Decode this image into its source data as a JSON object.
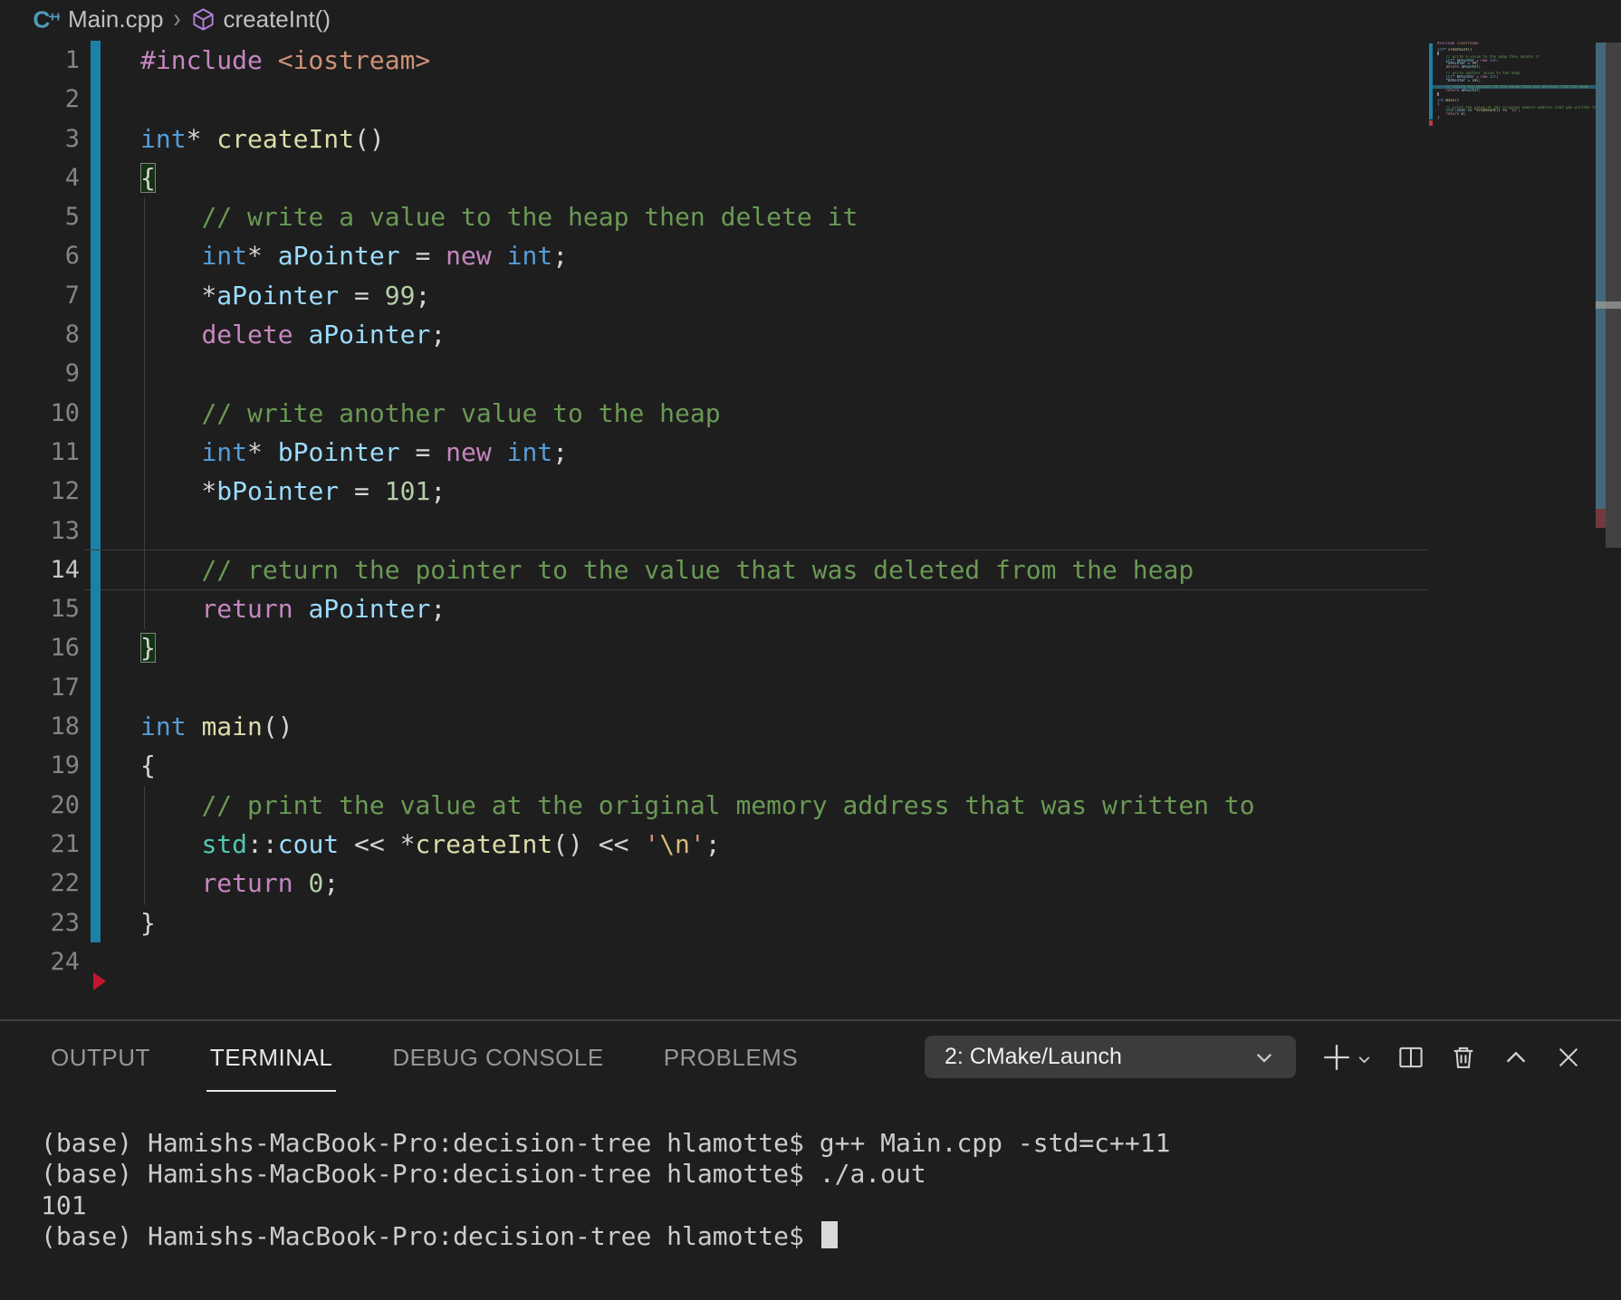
{
  "breadcrumb": {
    "file": "Main.cpp",
    "symbol": "createInt()"
  },
  "editor": {
    "cursor_line": 14,
    "lines": [
      {
        "n": 1,
        "git": true,
        "tokens": [
          [
            "pp",
            "#include"
          ],
          [
            "pl",
            " "
          ],
          [
            "str",
            "<iostream>"
          ]
        ]
      },
      {
        "n": 2,
        "git": true,
        "tokens": []
      },
      {
        "n": 3,
        "git": true,
        "tokens": [
          [
            "kw",
            "int"
          ],
          [
            "pl",
            "* "
          ],
          [
            "fn",
            "createInt"
          ],
          [
            "pl",
            "()"
          ]
        ]
      },
      {
        "n": 4,
        "git": true,
        "tokens": [
          [
            "brk",
            "{"
          ]
        ]
      },
      {
        "n": 5,
        "git": true,
        "tokens": [
          [
            "pl",
            "    "
          ],
          [
            "cm",
            "// write a value to the heap then delete it"
          ]
        ]
      },
      {
        "n": 6,
        "git": true,
        "tokens": [
          [
            "pl",
            "    "
          ],
          [
            "kw",
            "int"
          ],
          [
            "pl",
            "* "
          ],
          [
            "var",
            "aPointer"
          ],
          [
            "pl",
            " = "
          ],
          [
            "kwp",
            "new"
          ],
          [
            "pl",
            " "
          ],
          [
            "kw",
            "int"
          ],
          [
            "pl",
            ";"
          ]
        ]
      },
      {
        "n": 7,
        "git": true,
        "tokens": [
          [
            "pl",
            "    *"
          ],
          [
            "var",
            "aPointer"
          ],
          [
            "pl",
            " = "
          ],
          [
            "num",
            "99"
          ],
          [
            "pl",
            ";"
          ]
        ]
      },
      {
        "n": 8,
        "git": true,
        "tokens": [
          [
            "pl",
            "    "
          ],
          [
            "kwp",
            "delete"
          ],
          [
            "pl",
            " "
          ],
          [
            "var",
            "aPointer"
          ],
          [
            "pl",
            ";"
          ]
        ]
      },
      {
        "n": 9,
        "git": true,
        "tokens": []
      },
      {
        "n": 10,
        "git": true,
        "tokens": [
          [
            "pl",
            "    "
          ],
          [
            "cm",
            "// write another value to the heap"
          ]
        ]
      },
      {
        "n": 11,
        "git": true,
        "tokens": [
          [
            "pl",
            "    "
          ],
          [
            "kw",
            "int"
          ],
          [
            "pl",
            "* "
          ],
          [
            "var",
            "bPointer"
          ],
          [
            "pl",
            " = "
          ],
          [
            "kwp",
            "new"
          ],
          [
            "pl",
            " "
          ],
          [
            "kw",
            "int"
          ],
          [
            "pl",
            ";"
          ]
        ]
      },
      {
        "n": 12,
        "git": true,
        "tokens": [
          [
            "pl",
            "    *"
          ],
          [
            "var",
            "bPointer"
          ],
          [
            "pl",
            " = "
          ],
          [
            "num",
            "101"
          ],
          [
            "pl",
            ";"
          ]
        ]
      },
      {
        "n": 13,
        "git": true,
        "tokens": []
      },
      {
        "n": 14,
        "git": true,
        "tokens": [
          [
            "pl",
            "    "
          ],
          [
            "cm",
            "// return the pointer to the value that was deleted from the heap"
          ]
        ]
      },
      {
        "n": 15,
        "git": true,
        "tokens": [
          [
            "pl",
            "    "
          ],
          [
            "kwp",
            "return"
          ],
          [
            "pl",
            " "
          ],
          [
            "var",
            "aPointer"
          ],
          [
            "pl",
            ";"
          ]
        ]
      },
      {
        "n": 16,
        "git": true,
        "tokens": [
          [
            "brk",
            "}"
          ]
        ]
      },
      {
        "n": 17,
        "git": true,
        "tokens": []
      },
      {
        "n": 18,
        "git": true,
        "tokens": [
          [
            "kw",
            "int"
          ],
          [
            "pl",
            " "
          ],
          [
            "fn",
            "main"
          ],
          [
            "pl",
            "()"
          ]
        ]
      },
      {
        "n": 19,
        "git": true,
        "tokens": [
          [
            "pl",
            "{"
          ]
        ]
      },
      {
        "n": 20,
        "git": true,
        "tokens": [
          [
            "pl",
            "    "
          ],
          [
            "cm",
            "// print the value at the original memory address that was written to"
          ]
        ]
      },
      {
        "n": 21,
        "git": true,
        "tokens": [
          [
            "pl",
            "    "
          ],
          [
            "ns",
            "std"
          ],
          [
            "pl",
            "::"
          ],
          [
            "var",
            "cout"
          ],
          [
            "pl",
            " << *"
          ],
          [
            "fn",
            "createInt"
          ],
          [
            "pl",
            "() << "
          ],
          [
            "str",
            "'"
          ],
          [
            "esc",
            "\\n"
          ],
          [
            "str",
            "'"
          ],
          [
            "pl",
            ";"
          ]
        ]
      },
      {
        "n": 22,
        "git": true,
        "tokens": [
          [
            "pl",
            "    "
          ],
          [
            "kwp",
            "return"
          ],
          [
            "pl",
            " "
          ],
          [
            "num",
            "0"
          ],
          [
            "pl",
            ";"
          ]
        ]
      },
      {
        "n": 23,
        "git": true,
        "tokens": [
          [
            "pl",
            "}"
          ]
        ]
      },
      {
        "n": 24,
        "git": false,
        "tokens": []
      }
    ]
  },
  "panel": {
    "tabs": [
      {
        "label": "OUTPUT",
        "active": false
      },
      {
        "label": "TERMINAL",
        "active": true
      },
      {
        "label": "DEBUG CONSOLE",
        "active": false
      },
      {
        "label": "PROBLEMS",
        "active": false
      }
    ],
    "launch_selector": "2: CMake/Launch"
  },
  "terminal": {
    "lines": [
      {
        "text": "(base) Hamishs-MacBook-Pro:decision-tree hlamotte$ g++ Main.cpp -std=c++11",
        "cursor": false
      },
      {
        "text": "(base) Hamishs-MacBook-Pro:decision-tree hlamotte$ ./a.out",
        "cursor": false
      },
      {
        "text": "101",
        "cursor": false
      },
      {
        "text": "(base) Hamishs-MacBook-Pro:decision-tree hlamotte$ ",
        "cursor": true
      }
    ]
  },
  "icons": {
    "cpp-file-icon": "C++ blue file glyph",
    "symbol-method-icon": "purple cube",
    "breadcrumb-separator-icon": "chevron-right",
    "dropdown-chevron-icon": "chevron-down",
    "new-terminal-icon": "plus",
    "terminal-profile-icon": "small chevron-down",
    "split-terminal-icon": "split square",
    "kill-terminal-icon": "trash can",
    "maximize-panel-icon": "chevron-up",
    "close-panel-icon": "x"
  },
  "colors": {
    "bg": "#1e1e1e",
    "keyword_blue": "#569cd6",
    "keyword_pink": "#c586c0",
    "function_yellow": "#dcdcaa",
    "variable_blue": "#9cdcfe",
    "namespace_teal": "#4ec9b0",
    "number_green": "#b5cea8",
    "comment_green": "#6a9955",
    "string_orange": "#ce9178",
    "escape_yellow": "#d7ba7d",
    "plain": "#d4d4d4",
    "line_number": "#858585",
    "line_number_active": "#c6c6c6",
    "git_modified": "#1b81a8",
    "error_red": "#c2172d",
    "minimap_highlight": "#2b5d6e",
    "scrollbar_teal": "#44687a",
    "scrollbar_gray": "#424242",
    "scrollbar_red": "#74393f",
    "panel_border": "#3f3f3f",
    "tab_active": "#e7e7e7",
    "tab_inactive": "#969696",
    "dropdown_bg": "#3c3c3c",
    "terminal_fg": "#cccccc",
    "breadcrumb_fg": "#c0c0c0",
    "cpp_icon_blue": "#519aba",
    "symbol_icon_purple": "#b180d7"
  }
}
